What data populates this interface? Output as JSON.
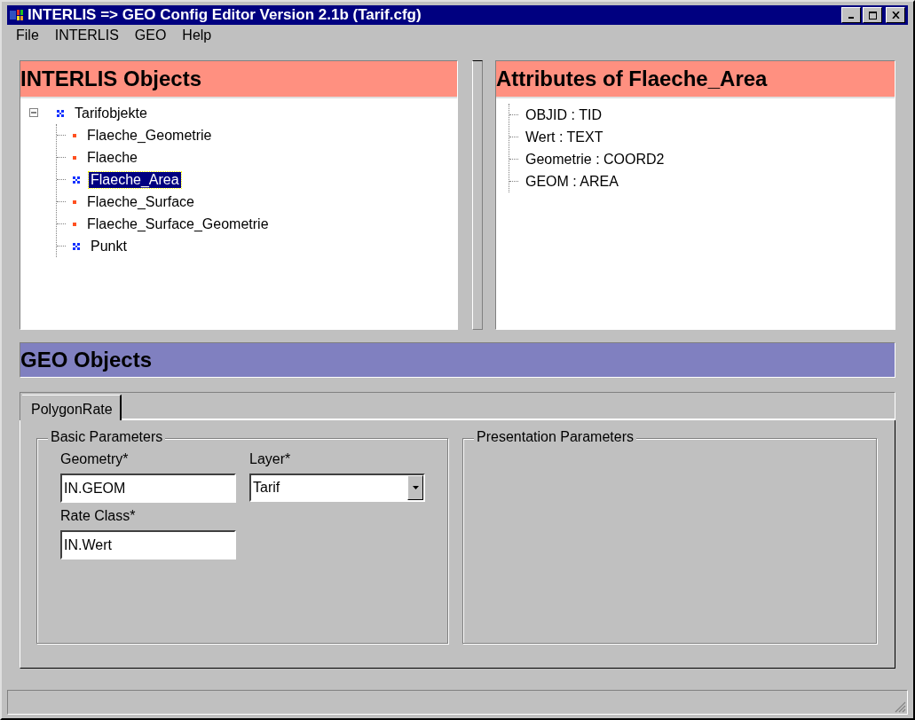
{
  "window": {
    "title": "INTERLIS => GEO Config Editor Version 2.1b (Tarif.cfg)"
  },
  "menu": [
    "File",
    "INTERLIS",
    "GEO",
    "Help"
  ],
  "interlis_panel": {
    "title": "INTERLIS Objects",
    "tree": [
      {
        "label": "Tarifobjekte",
        "kind": "class",
        "expanded": true,
        "selected": false,
        "children": [
          {
            "label": "Flaeche_Geometrie",
            "kind": "item",
            "selected": false
          },
          {
            "label": "Flaeche",
            "kind": "item",
            "selected": false
          },
          {
            "label": "Flaeche_Area",
            "kind": "class",
            "selected": true
          },
          {
            "label": "Flaeche_Surface",
            "kind": "item",
            "selected": false
          },
          {
            "label": "Flaeche_Surface_Geometrie",
            "kind": "item",
            "selected": false
          },
          {
            "label": "Punkt",
            "kind": "class",
            "selected": false
          }
        ]
      }
    ]
  },
  "attributes_panel": {
    "title": "Attributes of Flaeche_Area",
    "items": [
      "OBJID : TID",
      "Wert : TEXT",
      "Geometrie : COORD2",
      "GEOM : AREA"
    ]
  },
  "geo_panel": {
    "title": "GEO Objects",
    "tabs": [
      {
        "label": "PolygonRate",
        "selected": true
      }
    ],
    "basic_parameters": {
      "title": "Basic Parameters",
      "geometry": {
        "label": "Geometry*",
        "value": "IN.GEOM"
      },
      "layer": {
        "label": "Layer*",
        "value": "Tarif"
      },
      "rate_class": {
        "label": "Rate Class*",
        "value": "IN.Wert"
      }
    },
    "presentation_parameters": {
      "title": "Presentation Parameters"
    }
  }
}
